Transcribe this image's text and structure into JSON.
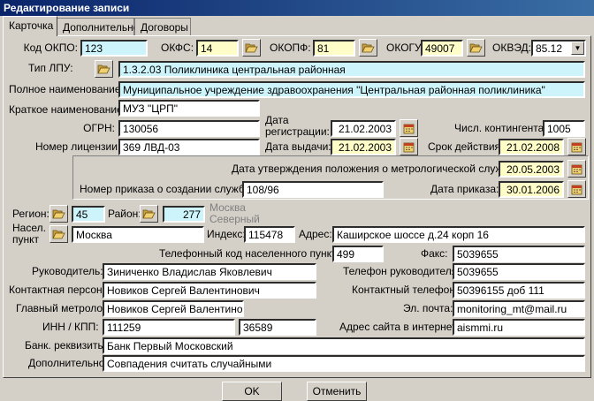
{
  "window": {
    "title": "Редактирование записи"
  },
  "tabs": [
    "Карточка",
    "Дополнительно",
    "Договоры"
  ],
  "row1": {
    "okpo_label": "Код ОКПО:",
    "okpo": "123",
    "okfs_label": "ОКФС:",
    "okfs": "14",
    "okopf_label": "ОКОПФ:",
    "okopf": "81",
    "okogu_label": "ОКОГУ:",
    "okogu": "49007",
    "okved_label": "ОКВЭД:",
    "okved": "85.12"
  },
  "lpu": {
    "label": "Тип ЛПУ:",
    "value": "1.3.2.03 Поликлиника центральная районная"
  },
  "full_name": {
    "label": "Полное наименование:",
    "value": "Муниципальное учреждение здравоохранения \"Центральная районная поликлиника\""
  },
  "short_name": {
    "label": "Краткое наименование:",
    "value": "МУЗ \"ЦРП\""
  },
  "ogrn": {
    "label": "ОГРН:",
    "value": "130056"
  },
  "reg_date": {
    "label_line1": "Дата",
    "label_line2": "регистрации:",
    "value": "21.02.2003"
  },
  "contingent": {
    "label": "Числ. контингента:",
    "value": "1005"
  },
  "license": {
    "label": "Номер лицензии:",
    "value": "369 ЛВД-03"
  },
  "issue_date": {
    "label": "Дата выдачи:",
    "value": "21.02.2003"
  },
  "validity": {
    "label": "Срок действия:",
    "value": "21.02.2008"
  },
  "metro": {
    "approval_label": "Дата утверждения положения о метрологической службе:",
    "approval_date": "20.05.2003",
    "order_label": "Номер приказа о создании службы:",
    "order_number": "108/96",
    "order_date_label": "Дата приказа:",
    "order_date": "30.01.2006"
  },
  "region": {
    "label": "Регион:",
    "value": "45",
    "district_label": "Район:",
    "district": "277",
    "region_name": "Москва",
    "district_name": "Северный"
  },
  "settlement": {
    "label_line1": "Насел.",
    "label_line2": "пункт",
    "value": "Москва"
  },
  "index": {
    "label": "Индекс:",
    "value": "115478"
  },
  "address": {
    "label": "Адрес:",
    "value": "Каширское шоссе д.24 корп 16"
  },
  "phone_code": {
    "label": "Телефонный код населенного пункта:",
    "value": "499"
  },
  "fax": {
    "label": "Факс:",
    "value": "5039655"
  },
  "head": {
    "label": "Руководитель:",
    "value": "Зиниченко Владислав Яковлевич"
  },
  "head_phone": {
    "label": "Телефон руководителя:",
    "value": "5039655"
  },
  "contact": {
    "label": "Контактная персона:",
    "value": "Новиков Сергей Валентинович"
  },
  "contact_phone": {
    "label": "Контактный телефон:",
    "value": "50396155 доб 111"
  },
  "metrologist": {
    "label": "Главный метролог:",
    "value": "Новиков Сергей Валентинович"
  },
  "email": {
    "label": "Эл. почта:",
    "value": "monitoring_mt@mail.ru"
  },
  "inn": {
    "label": "ИНН / КПП:",
    "inn": "111259",
    "kpp": "36589"
  },
  "website": {
    "label": "Адрес сайта в интернет:",
    "value": "aismmi.ru"
  },
  "bank": {
    "label": "Банк. реквизиты:",
    "value": "Банк Первый Московский"
  },
  "extra": {
    "label": "Дополнительно:",
    "value": "Совпадения считать случайными"
  },
  "buttons": {
    "ok": "OK",
    "cancel": "Отменить"
  },
  "colors": {
    "titlebar": "#0a246a",
    "face": "#d4d0c8",
    "cyan_field": "#cdf4fb",
    "yellow_field": "#fefdc8"
  },
  "icons": {
    "folder_button": "open-folder-icon",
    "calendar_button": "calendar-icon"
  }
}
